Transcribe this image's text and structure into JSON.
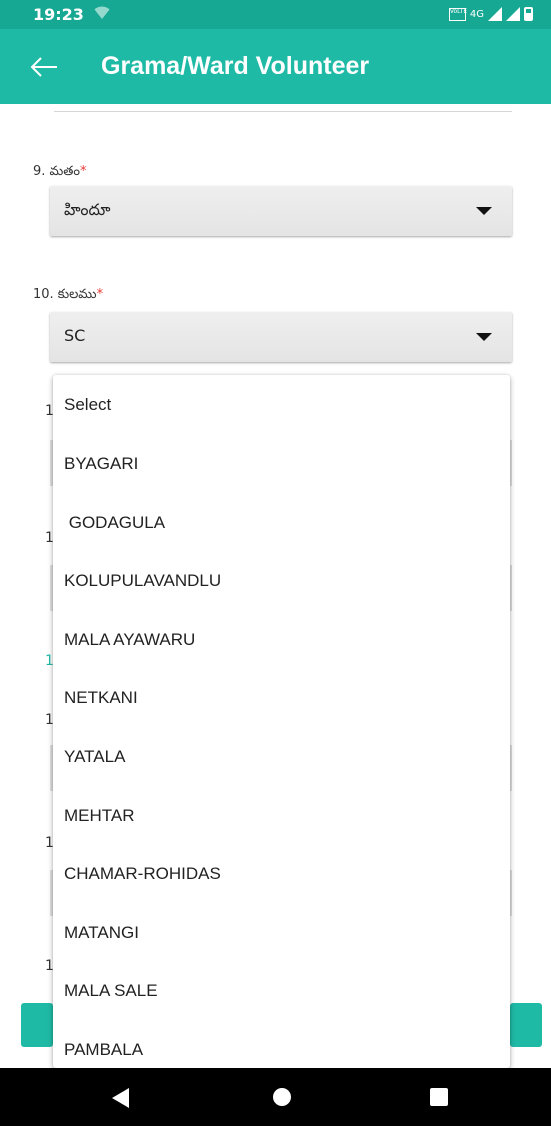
{
  "status_bar": {
    "time": "19:23",
    "network": "4G",
    "volte_label": "VoLTE",
    "icons": [
      "wifi-icon",
      "volte-icon",
      "signal-icon",
      "signal-icon",
      "battery-icon"
    ]
  },
  "app_bar": {
    "title": "Grama/Ward Volunteer",
    "back_icon": "arrow-left-icon",
    "color": "#1fbaa6"
  },
  "form": {
    "religion": {
      "label": "9. మతం",
      "required_mark": "*",
      "value": "హిందూ"
    },
    "caste": {
      "label": "10. కులము",
      "required_mark": "*",
      "value": "SC"
    }
  },
  "background_fragments": [
    "1",
    "1",
    "1",
    "1",
    "1",
    "1"
  ],
  "dropdown": {
    "options": [
      "Select",
      "BYAGARI",
      " GODAGULA",
      "KOLUPULAVANDLU",
      "MALA AYAWARU",
      "NETKANI",
      "YATALA",
      "MEHTAR",
      "CHAMAR-ROHIDAS",
      "MATANGI",
      "MALA SALE",
      "PAMBALA"
    ]
  },
  "nav_bar": {
    "icons": [
      "back-triangle-icon",
      "home-circle-icon",
      "recents-square-icon"
    ]
  },
  "colors": {
    "status_bar": "#16a893",
    "accent": "#1fbaa6",
    "required": "#e53935"
  }
}
